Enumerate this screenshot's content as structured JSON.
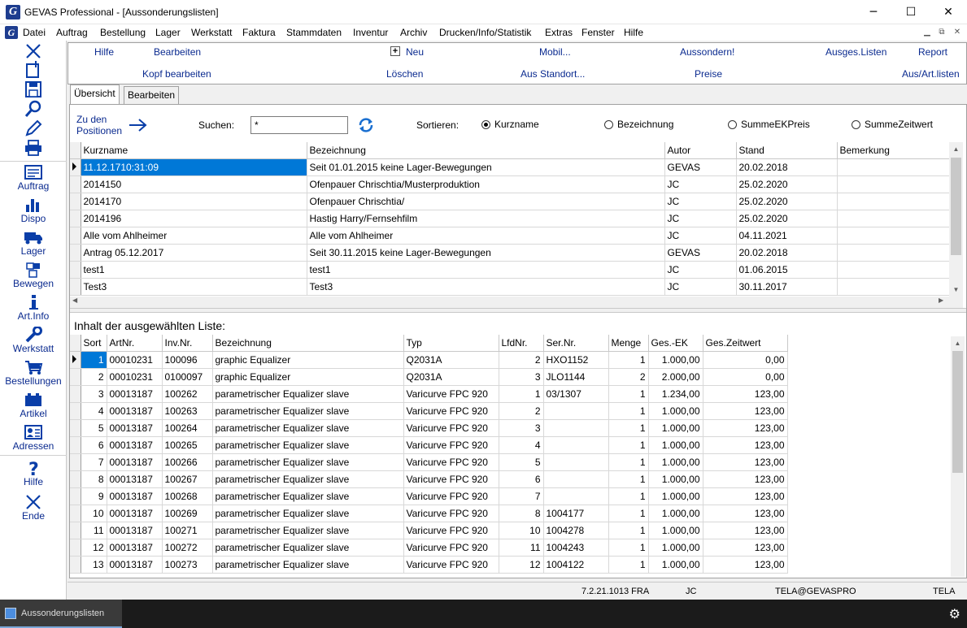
{
  "window": {
    "title": "GEVAS Professional - [Aussonderungslisten]",
    "app_icon_letter": "G"
  },
  "menu": [
    "Datei",
    "Auftrag",
    "Bestellung",
    "Lager",
    "Werkstatt",
    "Faktura",
    "Stammdaten",
    "Inventur",
    "Archiv",
    "Drucken/Info/Statistik",
    "Extras",
    "Fenster",
    "Hilfe"
  ],
  "sidebar": {
    "items": [
      "Auftrag",
      "Dispo",
      "Lager",
      "Bewegen",
      "Art.Info",
      "Werkstatt",
      "Bestellungen",
      "Artikel",
      "Adressen",
      "Hilfe",
      "Ende"
    ]
  },
  "toolbar": {
    "row1": [
      "Hilfe",
      "Bearbeiten",
      "Neu",
      "Mobil...",
      "Aussondern!",
      "Ausges.Listen",
      "Report"
    ],
    "row2": [
      "Kopf bearbeiten",
      "Löschen",
      "Aus Standort...",
      "Preise",
      "Aus/Art.listen"
    ]
  },
  "tabs": [
    "Übersicht",
    "Bearbeiten"
  ],
  "search": {
    "goto_line1": "Zu den",
    "goto_line2": "Positionen",
    "label": "Suchen:",
    "value": "*",
    "sort_label": "Sortieren:",
    "sort_options": [
      "Kurzname",
      "Bezeichnung",
      "SummeEKPreis",
      "SummeZeitwert"
    ],
    "sort_selected": "Kurzname"
  },
  "lists_table": {
    "columns": [
      "Kurzname",
      "Bezeichnung",
      "Autor",
      "Stand",
      "Bemerkung"
    ],
    "rows": [
      [
        "11.12.1710:31:09",
        "Seit 01.01.2015 keine Lager-Bewegungen",
        "GEVAS",
        "20.02.2018",
        ""
      ],
      [
        "2014150",
        "Ofenpauer Chrischtia/Musterproduktion",
        "JC",
        "25.02.2020",
        ""
      ],
      [
        "2014170",
        "Ofenpauer Chrischtia/",
        "JC",
        "25.02.2020",
        ""
      ],
      [
        "2014196",
        "Hastig Harry/Fernsehfilm",
        "JC",
        "25.02.2020",
        ""
      ],
      [
        "Alle vom Ahlheimer",
        "Alle vom Ahlheimer",
        "JC",
        "04.11.2021",
        ""
      ],
      [
        "Antrag 05.12.2017",
        "Seit 30.11.2015 keine Lager-Bewegungen",
        "GEVAS",
        "20.02.2018",
        ""
      ],
      [
        "test1",
        "test1",
        "JC",
        "01.06.2015",
        ""
      ],
      [
        "Test3",
        "Test3",
        "JC",
        "30.11.2017",
        ""
      ]
    ]
  },
  "content_label": "Inhalt der ausgewählten Liste:",
  "content_table": {
    "columns": [
      "Sort",
      "ArtNr.",
      "Inv.Nr.",
      "Bezeichnung",
      "Typ",
      "LfdNr.",
      "Ser.Nr.",
      "Menge",
      "Ges.-EK",
      "Ges.Zeitwert"
    ],
    "rows": [
      [
        "1",
        "00010231",
        "100096",
        "graphic Equalizer",
        "Q2031A",
        "2",
        "HXO1152",
        "1",
        "1.000,00",
        "0,00"
      ],
      [
        "2",
        "00010231",
        "0100097",
        "graphic Equalizer",
        "Q2031A",
        "3",
        "JLO1144",
        "2",
        "2.000,00",
        "0,00"
      ],
      [
        "3",
        "00013187",
        "100262",
        "parametrischer Equalizer slave",
        "Varicurve FPC 920",
        "1",
        "03/1307",
        "1",
        "1.234,00",
        "123,00"
      ],
      [
        "4",
        "00013187",
        "100263",
        "parametrischer Equalizer slave",
        "Varicurve FPC 920",
        "2",
        "",
        "1",
        "1.000,00",
        "123,00"
      ],
      [
        "5",
        "00013187",
        "100264",
        "parametrischer Equalizer slave",
        "Varicurve FPC 920",
        "3",
        "",
        "1",
        "1.000,00",
        "123,00"
      ],
      [
        "6",
        "00013187",
        "100265",
        "parametrischer Equalizer slave",
        "Varicurve FPC 920",
        "4",
        "",
        "1",
        "1.000,00",
        "123,00"
      ],
      [
        "7",
        "00013187",
        "100266",
        "parametrischer Equalizer slave",
        "Varicurve FPC 920",
        "5",
        "",
        "1",
        "1.000,00",
        "123,00"
      ],
      [
        "8",
        "00013187",
        "100267",
        "parametrischer Equalizer slave",
        "Varicurve FPC 920",
        "6",
        "",
        "1",
        "1.000,00",
        "123,00"
      ],
      [
        "9",
        "00013187",
        "100268",
        "parametrischer Equalizer slave",
        "Varicurve FPC 920",
        "7",
        "",
        "1",
        "1.000,00",
        "123,00"
      ],
      [
        "10",
        "00013187",
        "100269",
        "parametrischer Equalizer slave",
        "Varicurve FPC 920",
        "8",
        "1004177",
        "1",
        "1.000,00",
        "123,00"
      ],
      [
        "11",
        "00013187",
        "100271",
        "parametrischer Equalizer slave",
        "Varicurve FPC 920",
        "10",
        "1004278",
        "1",
        "1.000,00",
        "123,00"
      ],
      [
        "12",
        "00013187",
        "100272",
        "parametrischer Equalizer slave",
        "Varicurve FPC 920",
        "11",
        "1004243",
        "1",
        "1.000,00",
        "123,00"
      ],
      [
        "13",
        "00013187",
        "100273",
        "parametrischer Equalizer slave",
        "Varicurve FPC 920",
        "12",
        "1004122",
        "1",
        "1.000,00",
        "123,00"
      ]
    ]
  },
  "status": {
    "version": "7.2.21.1013 FRA",
    "user": "JC",
    "db": "TELA@GEVASPRO",
    "company": "TELA"
  },
  "taskbar": {
    "item": "Aussonderungslisten"
  },
  "colors": {
    "accent": "#0a2a8f",
    "selection": "#0078d7"
  }
}
